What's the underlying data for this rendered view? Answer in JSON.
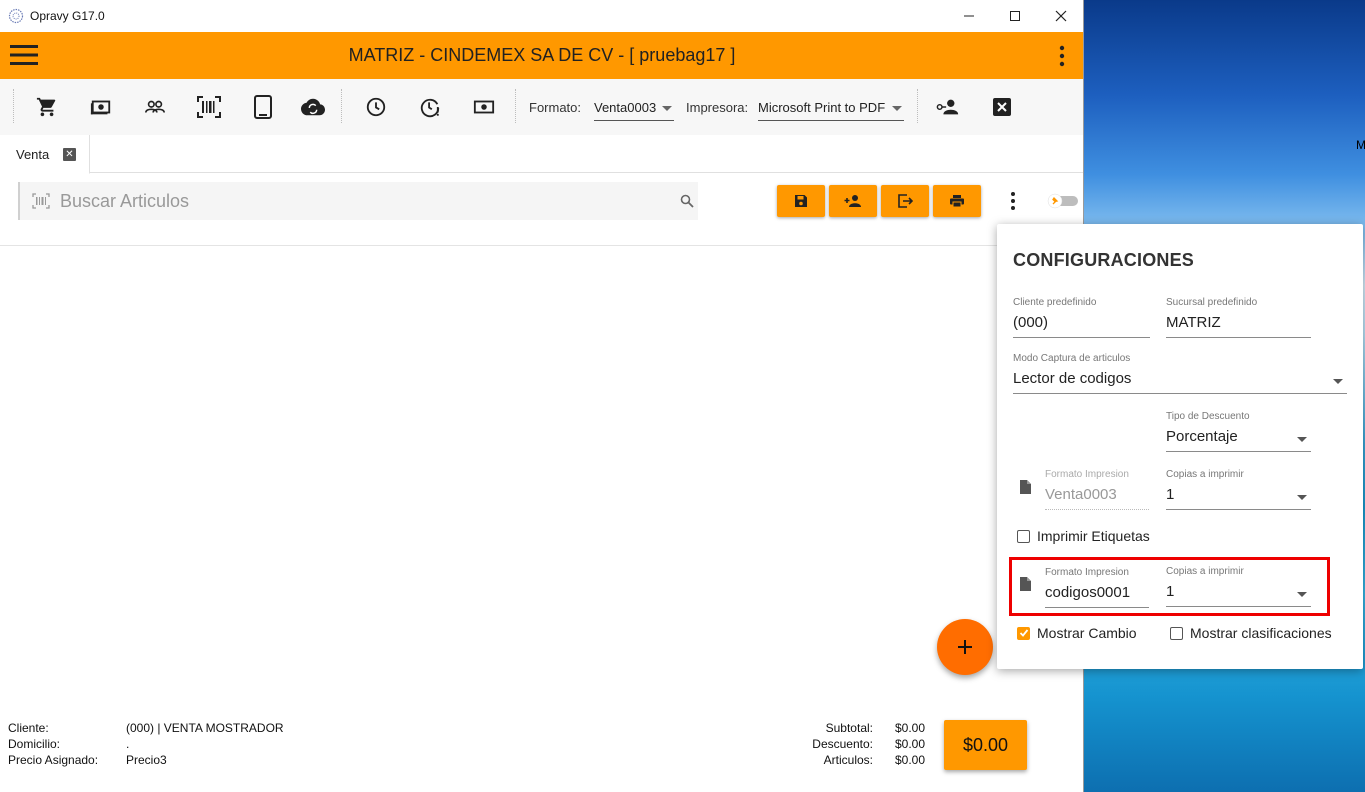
{
  "window": {
    "title": "Opravy G17.0"
  },
  "header": {
    "title": "MATRIZ - CINDEMEX SA DE CV - [ pruebag17 ]"
  },
  "toolbar": {
    "formato_label": "Formato:",
    "formato_value": "Venta0003",
    "impresora_label": "Impresora:",
    "impresora_value": "Microsoft Print to PDF"
  },
  "tab": {
    "label": "Venta",
    "close": "✕"
  },
  "search": {
    "placeholder": "Buscar Articulos"
  },
  "config": {
    "title": "CONFIGURACIONES",
    "cliente_label": "Cliente predefinido",
    "cliente_value": "(000)",
    "sucursal_label": "Sucursal predefinido",
    "sucursal_value": "MATRIZ",
    "modo_label": "Modo Captura de articulos",
    "modo_value": "Lector de codigos",
    "descuento_label": "Tipo de Descuento",
    "descuento_value": "Porcentaje",
    "formato1_label": "Formato Impresion",
    "formato1_value": "Venta0003",
    "copias1_label": "Copias a imprimir",
    "copias1_value": "1",
    "etiquetas_label": "Imprimir Etiquetas",
    "etiquetas_checked": false,
    "formato2_label": "Formato Impresion",
    "formato2_value": "codigos0001",
    "copias2_label": "Copias a imprimir",
    "copias2_value": "1",
    "cambio_label": "Mostrar Cambio",
    "cambio_checked": true,
    "clasif_label": "Mostrar clasificaciones",
    "clasif_checked": false
  },
  "footer": {
    "cliente_label": "Cliente:",
    "cliente_value": "(000) | VENTA MOSTRADOR",
    "domicilio_label": "Domicilio:",
    "domicilio_value": ".",
    "precio_label": "Precio Asignado:",
    "precio_value": "Precio3",
    "subtotal_label": "Subtotal:",
    "subtotal_value": "$0.00",
    "descuento_label": "Descuento:",
    "descuento_value": "$0.00",
    "articulos_label": "Articulos:",
    "articulos_value": "$0.00",
    "total": "$0.00"
  },
  "desktop": {
    "edge_text": "M"
  },
  "colors": {
    "accent": "#ff9800",
    "fab": "#ff6d00",
    "highlight": "#e00000"
  }
}
